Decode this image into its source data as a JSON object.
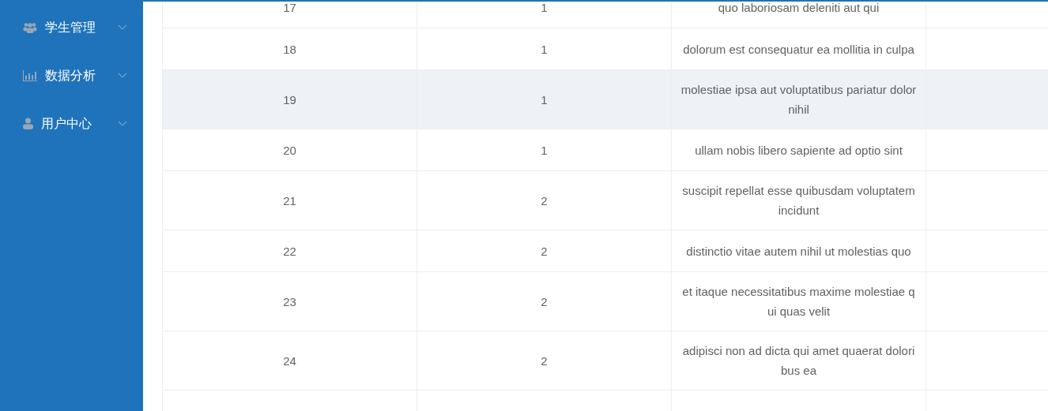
{
  "sidebar": {
    "items": [
      {
        "label": "学生管理",
        "kind": "users",
        "expanded": false
      },
      {
        "label": "数据分析",
        "kind": "chart",
        "expanded": false
      },
      {
        "label": "用户中心",
        "kind": "user",
        "expanded": false
      }
    ]
  },
  "table": {
    "rows": [
      {
        "cells": [
          "17",
          "1",
          "quo laboriosam deleniti aut qui"
        ],
        "hovered": false
      },
      {
        "cells": [
          "18",
          "1",
          "dolorum est consequatur ea mollitia in culpa"
        ],
        "hovered": false
      },
      {
        "cells": [
          "19",
          "1",
          "molestiae ipsa aut voluptatibus pariatur dolor nihil"
        ],
        "hovered": true
      },
      {
        "cells": [
          "20",
          "1",
          "ullam nobis libero sapiente ad optio sint"
        ],
        "hovered": false
      },
      {
        "cells": [
          "21",
          "2",
          "suscipit repellat esse quibusdam voluptatem incidunt"
        ],
        "hovered": false
      },
      {
        "cells": [
          "22",
          "2",
          "distinctio vitae autem nihil ut molestias quo"
        ],
        "hovered": false
      },
      {
        "cells": [
          "23",
          "2",
          "et itaque necessitatibus maxime molestiae qui quas velit"
        ],
        "hovered": false
      },
      {
        "cells": [
          "24",
          "2",
          "adipisci non ad dicta qui amet quaerat doloribus ea"
        ],
        "hovered": false
      }
    ]
  }
}
